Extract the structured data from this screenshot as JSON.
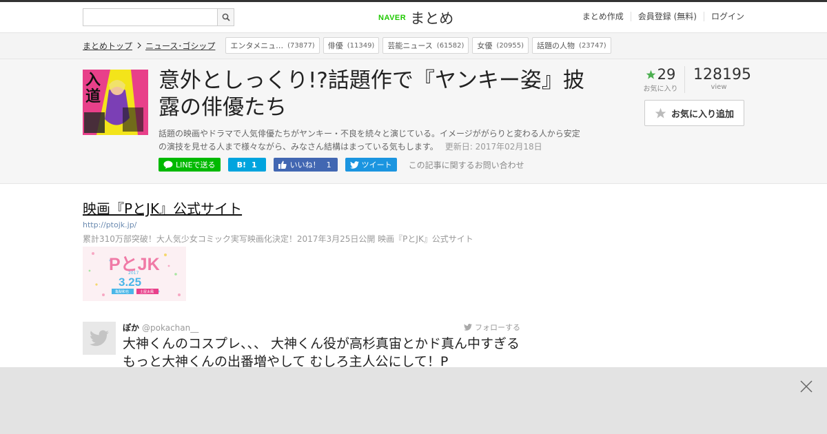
{
  "header": {
    "search_placeholder": "",
    "logo_naver": "NAVER",
    "logo_matome": "まとめ",
    "nav": [
      "まとめ作成",
      "会員登録 (無料)",
      "ログイン"
    ]
  },
  "breadcrumb": {
    "items": [
      "まとめトップ",
      "ニュース･ゴシップ"
    ],
    "tags": [
      {
        "label": "エンタメニュ…",
        "count": "(73877)"
      },
      {
        "label": "俳優",
        "count": "(11349)"
      },
      {
        "label": "芸能ニュース",
        "count": "(61582)"
      },
      {
        "label": "女優",
        "count": "(20955)"
      },
      {
        "label": "話題の人物",
        "count": "(23747)"
      }
    ]
  },
  "article": {
    "title": "意外としっくり!?話題作で『ヤンキー姿』披露の俳優たち",
    "description": "話題の映画やドラマで人気俳優たちがヤンキー・不良を続々と演じている。イメージががらりと変わる人から安定の演技を見せる人まで様々ながら、みなさん結構はまっている気もします。",
    "updated": "更新日: 2017年02月18日",
    "thumb_text": "入道"
  },
  "share": {
    "line": "LINEで送る",
    "hatena_label": "B!",
    "hatena_count": "1",
    "fb_label": "いいね！",
    "fb_count": "1",
    "tweet": "ツイート",
    "inquiry": "この記事に関するお問い合わせ"
  },
  "stats": {
    "favorites": "29",
    "favorites_label": "お気に入り",
    "views": "128195",
    "views_label": "view",
    "fav_button": "お気に入り追加"
  },
  "link_card": {
    "title": "映画『PとJK』公式サイト",
    "url": "http://ptojk.jp/",
    "description": "累計310万部突破！大人気少女コミック実写映画化決定！2017年3月25日公開 映画『PとJK』公式サイト",
    "img_logo": "PとJK",
    "img_year": "2017",
    "img_date": "3.25",
    "img_sub1": "亀梨和也",
    "img_sub2": "土屋太鳳"
  },
  "tweet": {
    "name": "ぽか",
    "handle": "@pokachan__",
    "follow": "フォローする",
    "text": "大神くんのコスプレ、、、 大神くん役が高杉真宙とかド真ん中すぎる もっと大神くんの出番増やして むしろ主人公にして！P"
  },
  "colors": {
    "accent_green": "#1ec800",
    "line_green": "#00b900",
    "hatena_blue": "#00a4de",
    "fb_blue": "#4267b2",
    "twitter_blue": "#1b95e0",
    "star_green": "#4caf50"
  }
}
